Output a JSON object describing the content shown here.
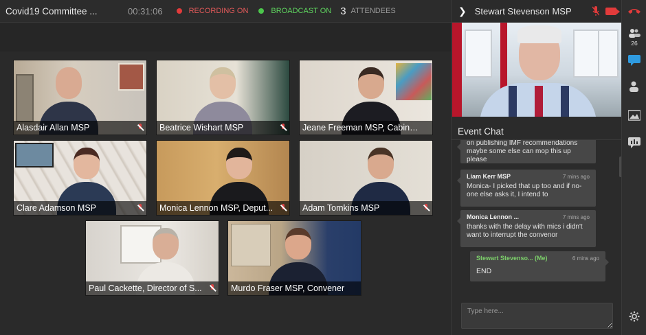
{
  "topbar": {
    "title": "Covid19 Committee ...",
    "timer": "00:31:06",
    "recording_label": "RECORDING ON",
    "broadcast_label": "BROADCAST ON",
    "attendee_count": "3",
    "attendee_label": "ATTENDEES"
  },
  "tiles": [
    {
      "name": "Alasdair Allan MSP"
    },
    {
      "name": "Beatrice Wishart MSP"
    },
    {
      "name": "Jeane Freeman MSP, Cabinet..."
    },
    {
      "name": "Clare Adamson MSP"
    },
    {
      "name": "Monica Lennon MSP, Deput..."
    },
    {
      "name": "Adam Tomkins MSP"
    },
    {
      "name": "Paul Cackette, Director of S..."
    },
    {
      "name": "Murdo Fraser MSP, Convener"
    }
  ],
  "presenter": {
    "name": "Stewart Stevenson MSP"
  },
  "chat": {
    "title": "Event Chat",
    "messages": [
      {
        "text": "on publishing IMF recommendations maybe some else can mop this up please"
      },
      {
        "sender": "Liam Kerr MSP",
        "time": "7 mins ago",
        "text": "Monica- I picked that up too and if no-one else asks it, I intend to"
      },
      {
        "sender": "Monica Lennon ...",
        "time": "7 mins ago",
        "text": "thanks with the delay with mics i didn't want to interrupt the convenor"
      },
      {
        "sender": "Stewart Stevenso... (Me)",
        "time": "6 mins ago",
        "text": "END"
      }
    ],
    "input_placeholder": "Type here..."
  },
  "rail": {
    "participants_count": "26"
  },
  "colors": {
    "recording": "#e23b3b",
    "broadcast": "#4cc64c",
    "me_sender": "#7ccf6a"
  }
}
